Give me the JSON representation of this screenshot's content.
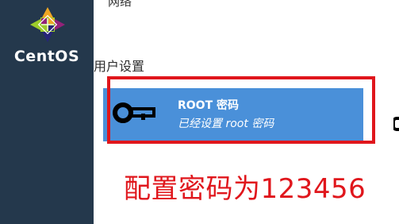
{
  "sidebar": {
    "brand": "CentOS",
    "logo_icon": "centos-logo-icon",
    "background_color": "#24384c"
  },
  "content": {
    "top_cut_text": "网络",
    "section_title": "用户设置",
    "root_spoke": {
      "icon": "key-icon",
      "title": "ROOT 密码",
      "status": "已经设置 root 密码",
      "color": "#4a90d9"
    },
    "right_edge_icon": "user-icon-partial"
  },
  "annotation": {
    "text": "配置密码为123456",
    "color": "#e0161c"
  }
}
